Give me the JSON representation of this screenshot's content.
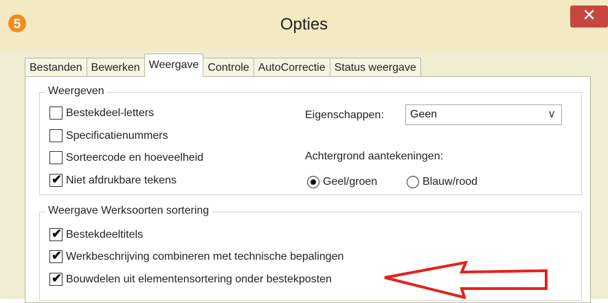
{
  "window": {
    "title": "Opties",
    "close_label": "✕",
    "app_icon_label": "5"
  },
  "tabs": [
    {
      "label": "Bestanden"
    },
    {
      "label": "Bewerken"
    },
    {
      "label": "Weergave",
      "active": true
    },
    {
      "label": "Controle"
    },
    {
      "label": "AutoCorrectie"
    },
    {
      "label": "Status weergave"
    }
  ],
  "weergeven": {
    "title": "Weergeven",
    "items": [
      {
        "label": "Bestekdeel-letters",
        "checked": false
      },
      {
        "label": "Specificatienummers",
        "checked": false
      },
      {
        "label": "Sorteercode en hoeveelheid",
        "checked": false
      },
      {
        "label": "Niet afdrukbare tekens",
        "checked": true
      }
    ],
    "eigenschappen_label": "Eigenschappen:",
    "eigenschappen_value": "Geen",
    "achtergrond_label": "Achtergrond aantekeningen:",
    "radio_options": [
      {
        "label": "Geel/groen",
        "selected": true
      },
      {
        "label": "Blauw/rood",
        "selected": false
      }
    ]
  },
  "werksoorten": {
    "title": "Weergave Werksoorten sortering",
    "items": [
      {
        "label": "Bestekdeeltitels",
        "checked": true
      },
      {
        "label": "Werkbeschrijving combineren met technische bepalingen",
        "checked": true
      },
      {
        "label": "Bouwdelen uit elementensortering onder bestekposten",
        "checked": true
      }
    ]
  },
  "check_glyph": "✔",
  "chevron_glyph": "∨",
  "colors": {
    "titlebar": "#f3e9c2",
    "close_button": "#c7463f",
    "app_icon": "#f08c1e",
    "arrow": "#e8201a"
  }
}
